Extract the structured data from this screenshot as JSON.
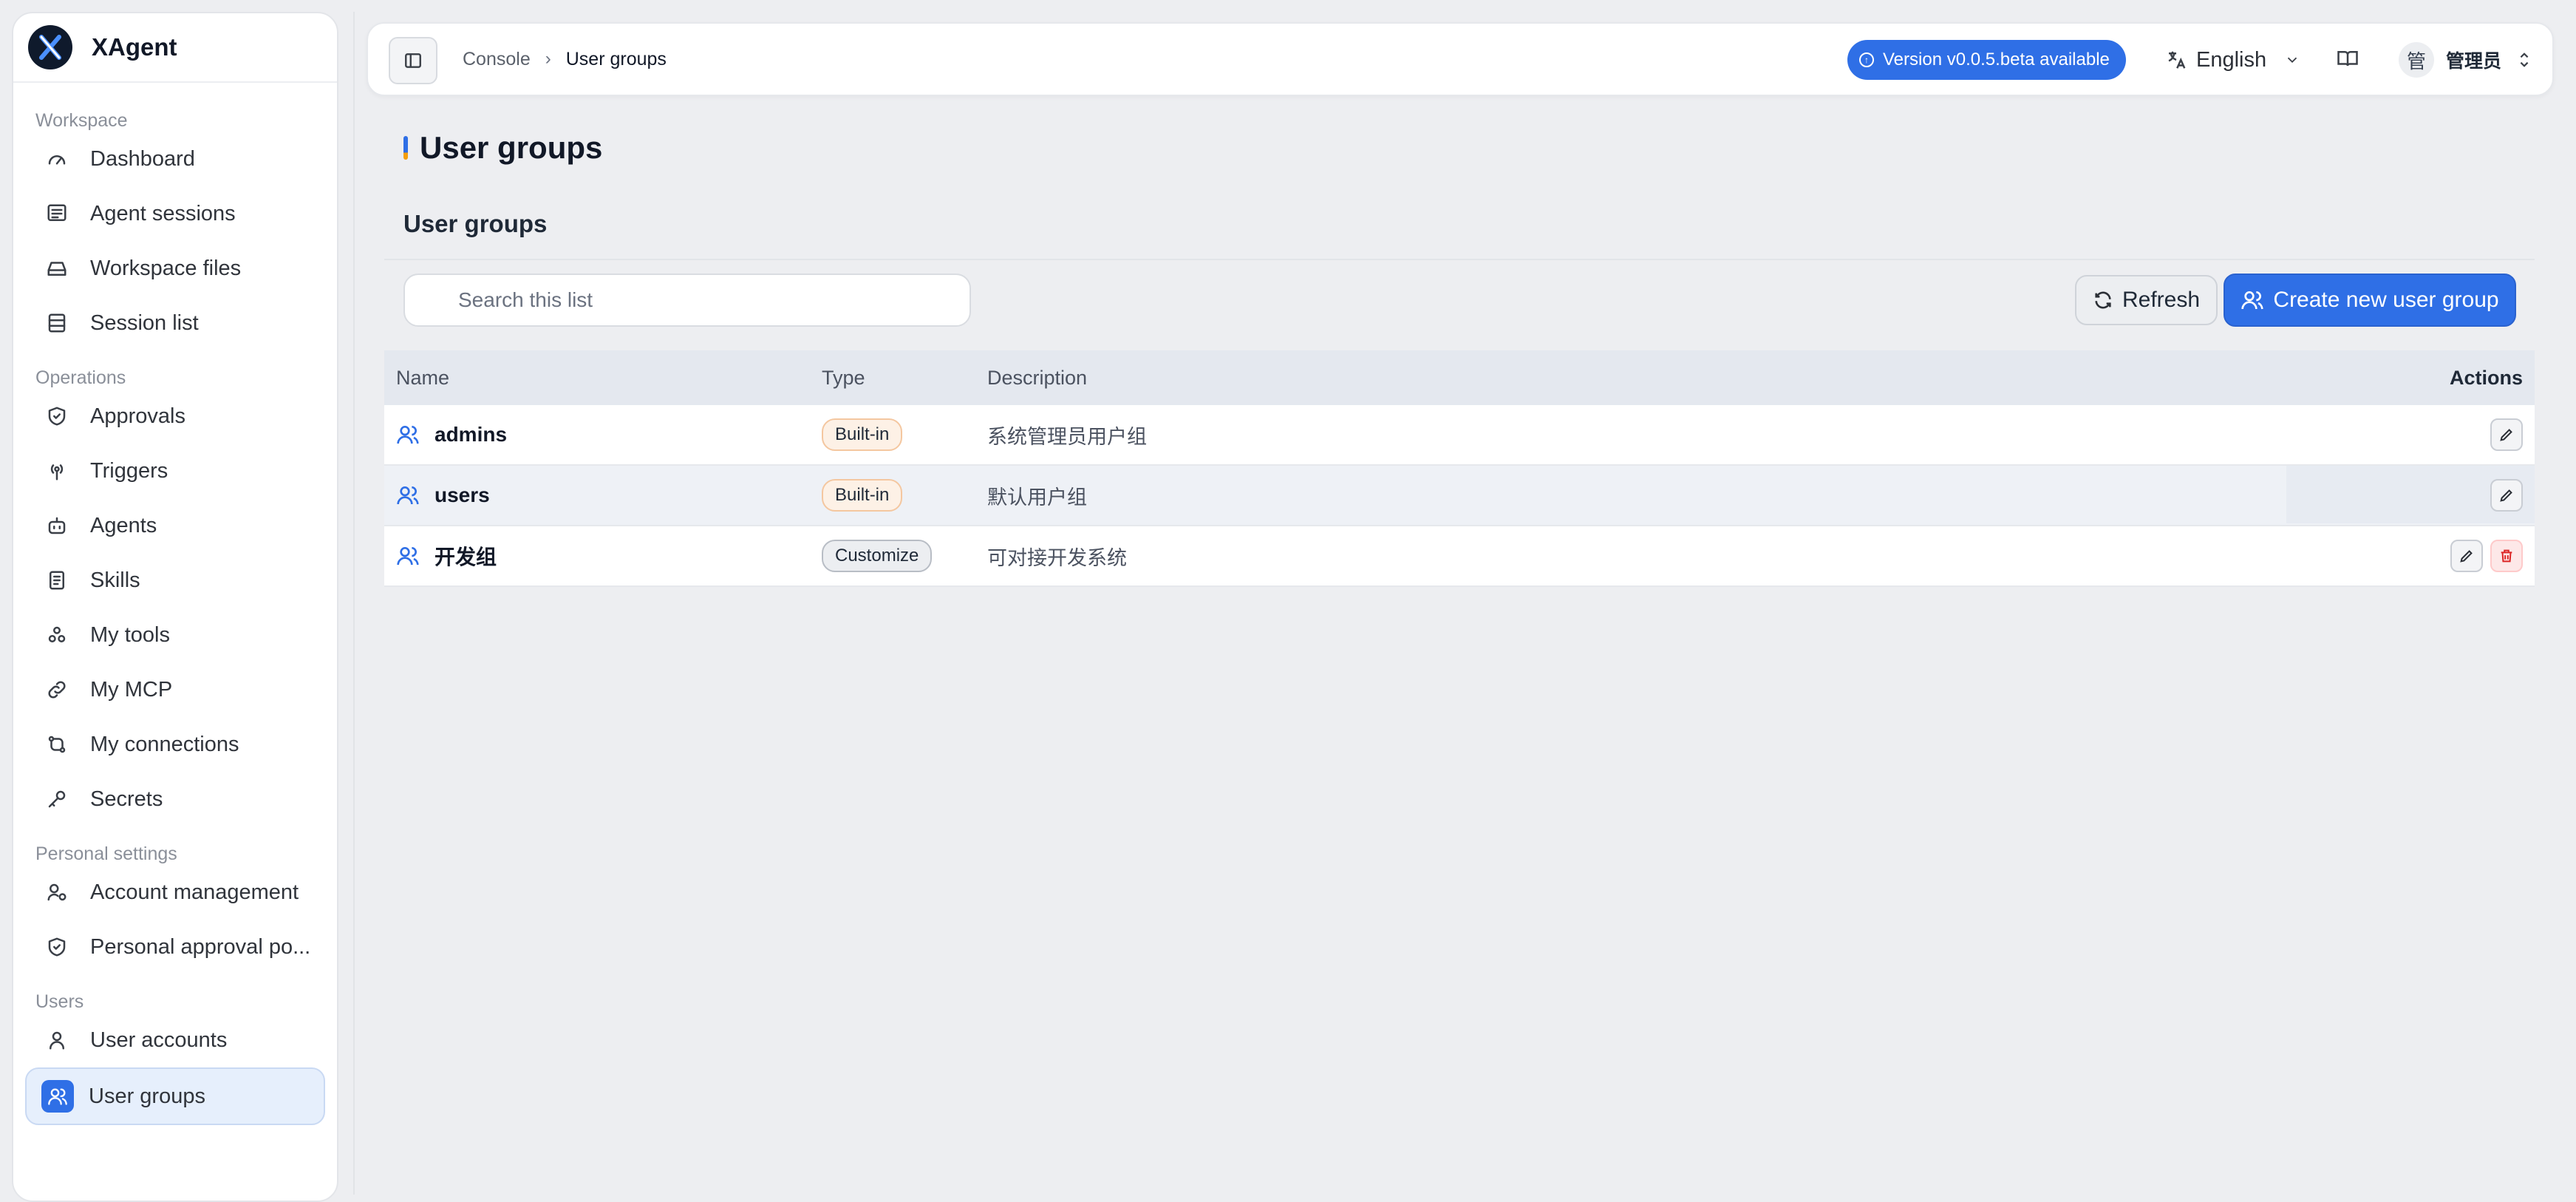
{
  "app": {
    "name": "XAgent"
  },
  "sidebar": {
    "sections": [
      {
        "title": "Workspace",
        "items": [
          {
            "label": "Dashboard",
            "icon": "gauge-icon"
          },
          {
            "label": "Agent sessions",
            "icon": "chat-list-icon"
          },
          {
            "label": "Workspace files",
            "icon": "drive-icon"
          },
          {
            "label": "Session list",
            "icon": "list-icon"
          }
        ]
      },
      {
        "title": "Operations",
        "items": [
          {
            "label": "Approvals",
            "icon": "shield-check-icon"
          },
          {
            "label": "Triggers",
            "icon": "radio-tower-icon"
          },
          {
            "label": "Agents",
            "icon": "bot-icon"
          },
          {
            "label": "Skills",
            "icon": "notebook-icon"
          },
          {
            "label": "My tools",
            "icon": "tools-icon"
          },
          {
            "label": "My MCP",
            "icon": "link-icon"
          },
          {
            "label": "My connections",
            "icon": "connections-icon"
          },
          {
            "label": "Secrets",
            "icon": "key-icon"
          }
        ]
      },
      {
        "title": "Personal settings",
        "items": [
          {
            "label": "Account management",
            "icon": "user-cog-icon"
          },
          {
            "label": "Personal approval po...",
            "icon": "shield-check-icon"
          }
        ]
      },
      {
        "title": "Users",
        "items": [
          {
            "label": "User accounts",
            "icon": "user-icon"
          },
          {
            "label": "User groups",
            "icon": "users-icon",
            "active": true
          }
        ]
      }
    ]
  },
  "topbar": {
    "breadcrumb": [
      "Console",
      "User groups"
    ],
    "version_label": "Version v0.0.5.beta available",
    "language": "English",
    "user_avatar": "管",
    "user_name": "管理员"
  },
  "page": {
    "title": "User groups",
    "section_title": "User groups",
    "search_placeholder": "Search this list",
    "refresh_label": "Refresh",
    "create_label": "Create new user group"
  },
  "table": {
    "columns": [
      "Name",
      "Type",
      "Description",
      "Actions"
    ],
    "rows": [
      {
        "name": "admins",
        "type": "Built-in",
        "description": "系统管理员用户组",
        "deletable": false
      },
      {
        "name": "users",
        "type": "Built-in",
        "description": "默认用户组",
        "deletable": false
      },
      {
        "name": "开发组",
        "type": "Customize",
        "description": "可对接开发系统",
        "deletable": true
      }
    ]
  },
  "colors": {
    "accent": "#2f6fe6",
    "danger": "#dc2626",
    "builtin_badge": "#fdf1e6"
  }
}
